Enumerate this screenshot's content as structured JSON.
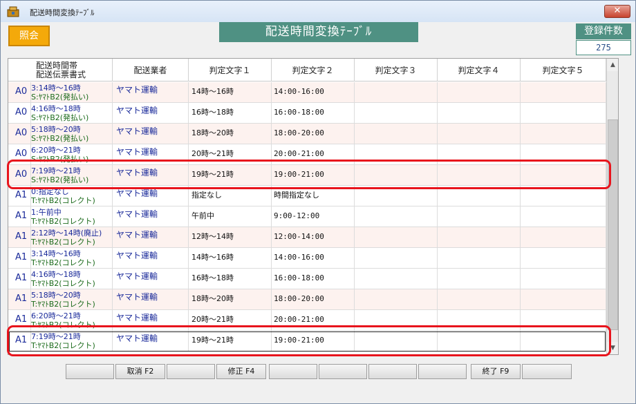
{
  "window": {
    "title": "配送時間変換ﾃｰﾌﾞﾙ",
    "close_symbol": "✕"
  },
  "header": {
    "inquiry_label": "照会",
    "banner_title": "配送時間変換ﾃｰﾌﾞﾙ",
    "count_label": "登録件数",
    "count_value": "275"
  },
  "columns": {
    "slot_line1": "配送時間帯",
    "slot_line2": "配送伝票書式",
    "carrier": "配送業者",
    "j1": "判定文字１",
    "j2": "判定文字２",
    "j3": "判定文字３",
    "j4": "判定文字４",
    "j5": "判定文字５"
  },
  "rows": [
    {
      "code": "A0",
      "slot": "3:14時～16時",
      "format": "S:ﾔﾏﾄB2(発払い)",
      "carrier": "ヤマト運輸",
      "j1": "14時～16時",
      "j2": "14:00-16:00",
      "j3": "",
      "j4": "",
      "j5": ""
    },
    {
      "code": "A0",
      "slot": "4:16時～18時",
      "format": "S:ﾔﾏﾄB2(発払い)",
      "carrier": "ヤマト運輸",
      "j1": "16時～18時",
      "j2": "16:00-18:00",
      "j3": "",
      "j4": "",
      "j5": ""
    },
    {
      "code": "A0",
      "slot": "5:18時～20時",
      "format": "S:ﾔﾏﾄB2(発払い)",
      "carrier": "ヤマト運輸",
      "j1": "18時～20時",
      "j2": "18:00-20:00",
      "j3": "",
      "j4": "",
      "j5": ""
    },
    {
      "code": "A0",
      "slot": "6:20時～21時",
      "format": "S:ﾔﾏﾄB2(発払い)",
      "carrier": "ヤマト運輸",
      "j1": "20時～21時",
      "j2": "20:00-21:00",
      "j3": "",
      "j4": "",
      "j5": ""
    },
    {
      "code": "A0",
      "slot": "7:19時～21時",
      "format": "S:ﾔﾏﾄB2(発払い)",
      "carrier": "ヤマト運輸",
      "j1": "19時～21時",
      "j2": "19:00-21:00",
      "j3": "",
      "j4": "",
      "j5": ""
    },
    {
      "code": "A1",
      "slot": "0:指定なし",
      "format": "T:ﾔﾏﾄB2(コレクト)",
      "carrier": "ヤマト運輸",
      "j1": "指定なし",
      "j2": "時間指定なし",
      "j3": "",
      "j4": "",
      "j5": ""
    },
    {
      "code": "A1",
      "slot": "1:午前中",
      "format": "T:ﾔﾏﾄB2(コレクト)",
      "carrier": "ヤマト運輸",
      "j1": "午前中",
      "j2": "9:00-12:00",
      "j3": "",
      "j4": "",
      "j5": ""
    },
    {
      "code": "A1",
      "slot": "2:12時～14時(廃止)",
      "format": "T:ﾔﾏﾄB2(コレクト)",
      "carrier": "ヤマト運輸",
      "j1": "12時～14時",
      "j2": "12:00-14:00",
      "j3": "",
      "j4": "",
      "j5": ""
    },
    {
      "code": "A1",
      "slot": "3:14時～16時",
      "format": "T:ﾔﾏﾄB2(コレクト)",
      "carrier": "ヤマト運輸",
      "j1": "14時～16時",
      "j2": "14:00-16:00",
      "j3": "",
      "j4": "",
      "j5": ""
    },
    {
      "code": "A1",
      "slot": "4:16時～18時",
      "format": "T:ﾔﾏﾄB2(コレクト)",
      "carrier": "ヤマト運輸",
      "j1": "16時～18時",
      "j2": "16:00-18:00",
      "j3": "",
      "j4": "",
      "j5": ""
    },
    {
      "code": "A1",
      "slot": "5:18時～20時",
      "format": "T:ﾔﾏﾄB2(コレクト)",
      "carrier": "ヤマト運輸",
      "j1": "18時～20時",
      "j2": "18:00-20:00",
      "j3": "",
      "j4": "",
      "j5": ""
    },
    {
      "code": "A1",
      "slot": "6:20時～21時",
      "format": "T:ﾔﾏﾄB2(コレクト)",
      "carrier": "ヤマト運輸",
      "j1": "20時～21時",
      "j2": "20:00-21:00",
      "j3": "",
      "j4": "",
      "j5": ""
    },
    {
      "code": "A1",
      "slot": "7:19時～21時",
      "format": "T:ﾔﾏﾄB2(コレクト)",
      "carrier": "ヤマト運輸",
      "j1": "19時～21時",
      "j2": "19:00-21:00",
      "j3": "",
      "j4": "",
      "j5": ""
    }
  ],
  "footer": {
    "b1": "",
    "cancel": "取消 F2",
    "b3": "",
    "modify": "修正 F4",
    "b5": "",
    "b6": "",
    "b7": "",
    "b8": "",
    "exit": "終了 F9",
    "b10": ""
  },
  "colors": {
    "accent_teal": "#4f9183",
    "inquiry_orange": "#f4a90a",
    "highlight_red": "#e8141c",
    "row_pink": "#fdf2ef"
  }
}
